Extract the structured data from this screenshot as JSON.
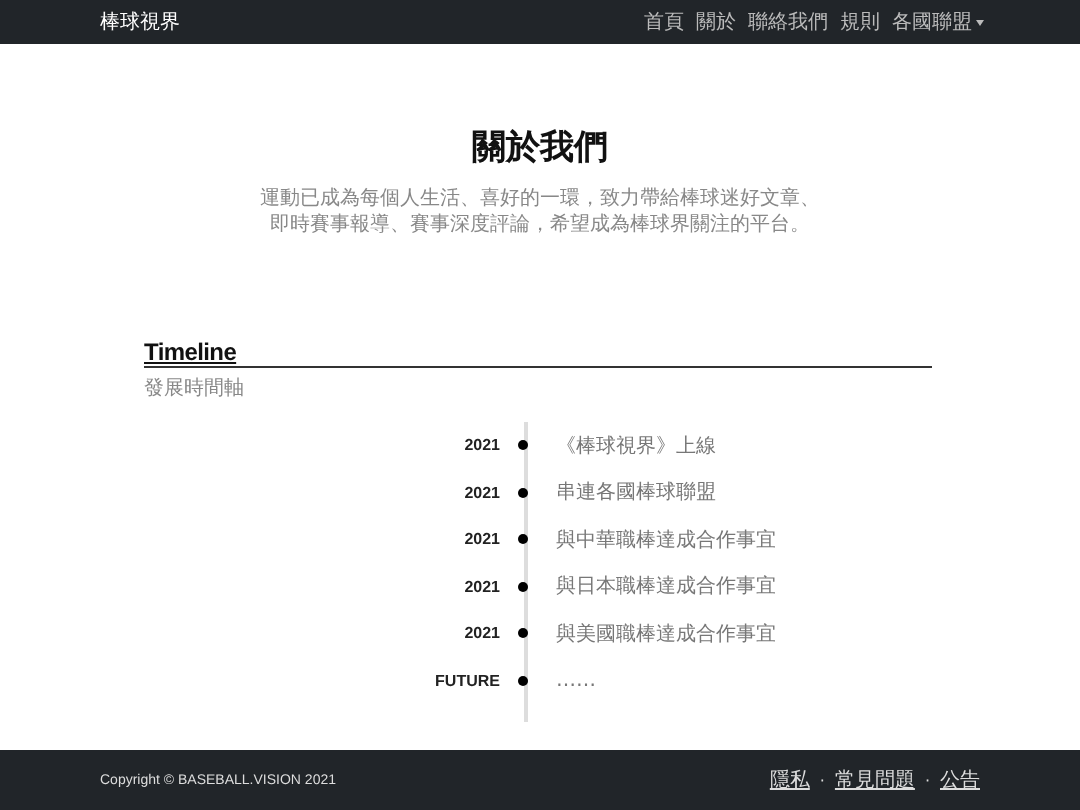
{
  "navbar": {
    "brand": "棒球視界",
    "links": [
      {
        "label": "首頁",
        "dropdown": false
      },
      {
        "label": "關於",
        "dropdown": false
      },
      {
        "label": "聯絡我們",
        "dropdown": false
      },
      {
        "label": "規則",
        "dropdown": false
      },
      {
        "label": "各國聯盟",
        "dropdown": true
      }
    ]
  },
  "hero": {
    "title": "關於我們",
    "lines": [
      "運動已成為每個人生活、喜好的一環，致力帶給棒球迷好文章、",
      "即時賽事報導、賽事深度評論，希望成為棒球界關注的平台。"
    ]
  },
  "timeline": {
    "title": "Timeline",
    "subtitle": "發展時間軸",
    "events": [
      {
        "year": "2021",
        "text": "《棒球視界》上線"
      },
      {
        "year": "2021",
        "text": "串連各國棒球聯盟"
      },
      {
        "year": "2021",
        "text": "與中華職棒達成合作事宜"
      },
      {
        "year": "2021",
        "text": "與日本職棒達成合作事宜"
      },
      {
        "year": "2021",
        "text": "與美國職棒達成合作事宜"
      },
      {
        "year": "FUTURE",
        "text": "……"
      }
    ]
  },
  "footer": {
    "copyright": "Copyright © BASEBALL.VISION 2021",
    "links": [
      "隱私",
      "常見問題",
      "公告"
    ],
    "separator": "·"
  }
}
